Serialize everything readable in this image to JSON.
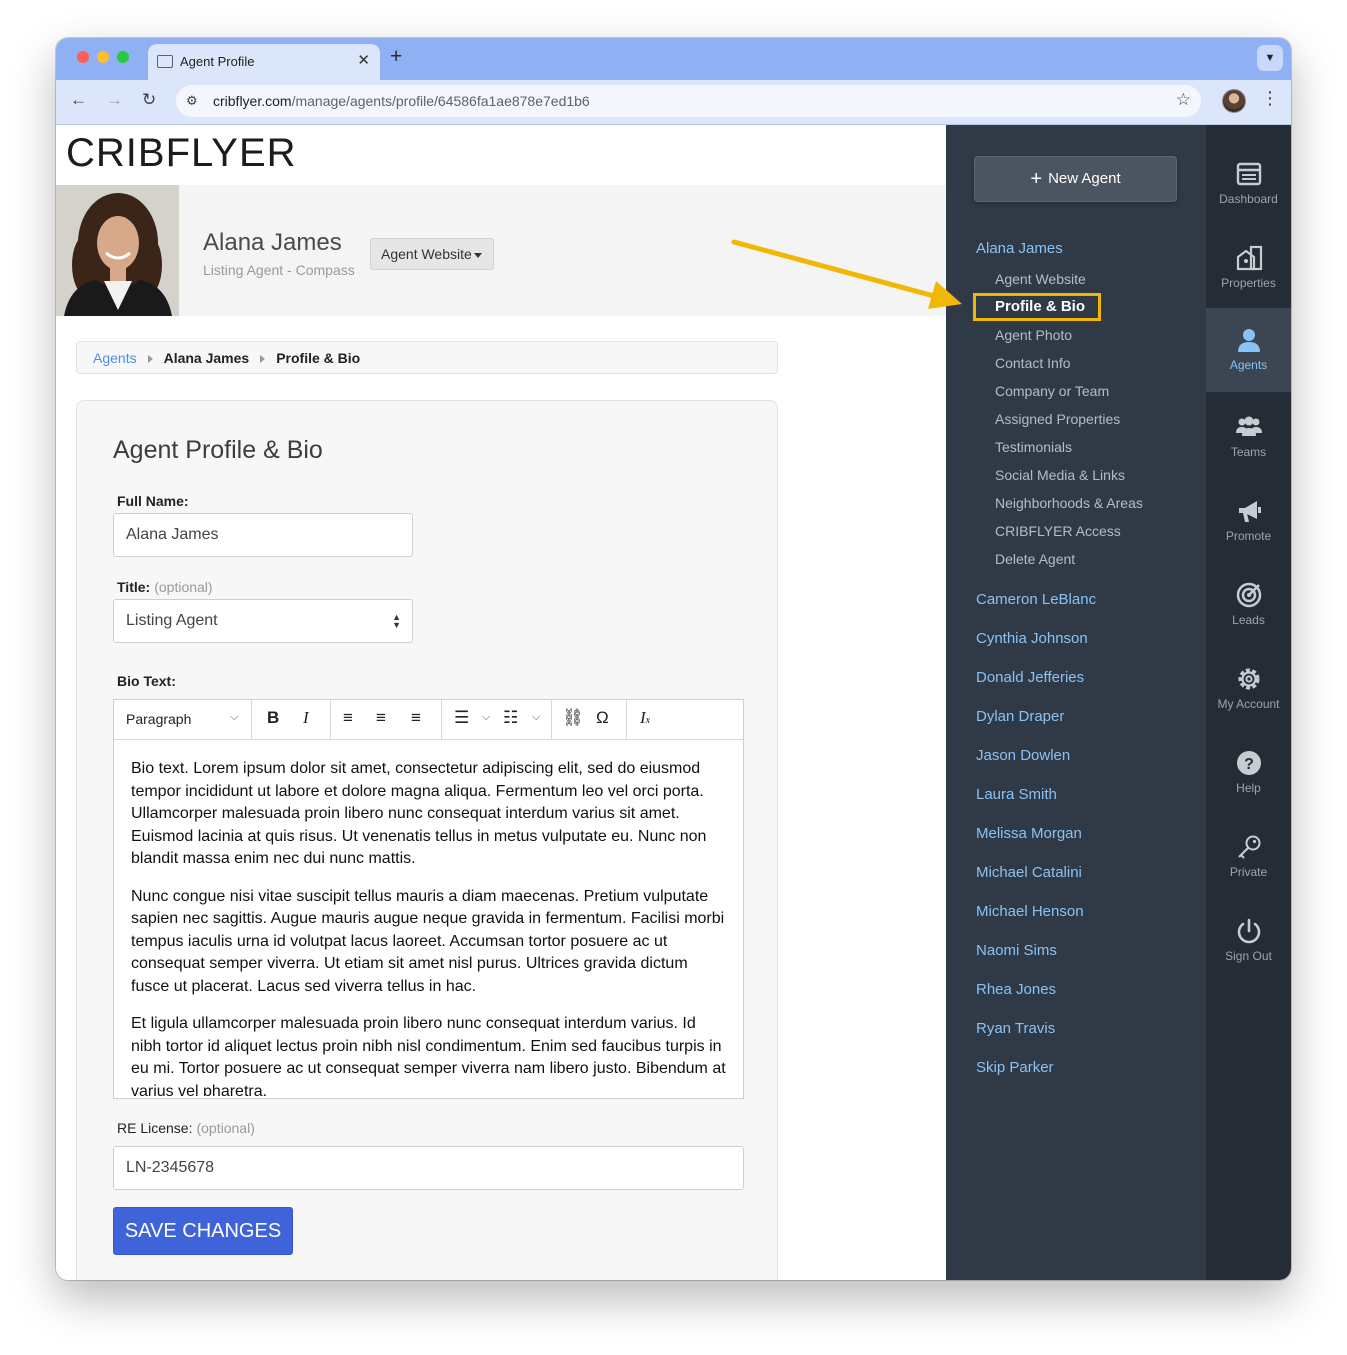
{
  "browser": {
    "tab_title": "Agent Profile",
    "url_host": "cribflyer.com",
    "url_path": "/manage/agents/profile/64586fa1ae878e7ed1b6"
  },
  "brand": {
    "logo": "CRIBFLYER"
  },
  "agent_header": {
    "name": "Alana James",
    "subtitle": "Listing Agent - Compass",
    "website_button": "Agent Website"
  },
  "breadcrumb": {
    "items": [
      "Agents",
      "Alana James",
      "Profile & Bio"
    ]
  },
  "form": {
    "title": "Agent Profile & Bio",
    "full_name_label": "Full Name:",
    "full_name_value": "Alana James",
    "title_label": "Title:",
    "optional": "(optional)",
    "title_value": "Listing Agent",
    "bio_label": "Bio Text:",
    "editor": {
      "block_format": "Paragraph",
      "paragraphs": [
        "Bio text. Lorem ipsum dolor sit amet, consectetur adipiscing elit, sed do eiusmod tempor incididunt ut labore et dolore magna aliqua. Fermentum leo vel orci porta. Ullamcorper malesuada proin libero nunc consequat interdum varius sit amet. Euismod lacinia at quis risus. Ut venenatis tellus in metus vulputate eu. Nunc non blandit massa enim nec dui nunc mattis.",
        "Nunc congue nisi vitae suscipit tellus mauris a diam maecenas. Pretium vulputate sapien nec sagittis. Augue mauris augue neque gravida in fermentum. Facilisi morbi tempus iaculis urna id volutpat lacus laoreet. Accumsan tortor posuere ac ut consequat semper viverra. Ut etiam sit amet nisl purus. Ultrices gravida dictum fusce ut placerat. Lacus sed viverra tellus in hac.",
        "Et ligula ullamcorper malesuada proin libero nunc consequat interdum varius. Id nibh tortor id aliquet lectus proin nibh nisl condimentum. Enim sed faucibus turpis in eu mi. Tortor posuere ac ut consequat semper viverra nam libero justo. Bibendum at varius vel pharetra."
      ]
    },
    "license_label": "RE License:",
    "license_value": "LN-2345678",
    "save_button": "SAVE CHANGES"
  },
  "agent_nav": {
    "new_agent": "New Agent",
    "current_agent": "Alana James",
    "sub_items": [
      "Agent Website",
      "Profile & Bio",
      "Agent Photo",
      "Contact Info",
      "Company or Team",
      "Assigned Properties",
      "Testimonials",
      "Social Media & Links",
      "Neighborhoods & Areas",
      "CRIBFLYER Access",
      "Delete Agent"
    ],
    "active_sub_item": "Profile & Bio",
    "other_agents": [
      "Cameron LeBlanc",
      "Cynthia Johnson",
      "Donald Jefferies",
      "Dylan Draper",
      "Jason Dowlen",
      "Laura Smith",
      "Melissa Morgan",
      "Michael Catalini",
      "Michael Henson",
      "Naomi Sims",
      "Rhea Jones",
      "Ryan Travis",
      "Skip Parker"
    ]
  },
  "icon_rail": [
    {
      "label": "Dashboard",
      "icon": "dashboard-icon"
    },
    {
      "label": "Properties",
      "icon": "properties-icon"
    },
    {
      "label": "Agents",
      "icon": "agents-icon",
      "active": true
    },
    {
      "label": "Teams",
      "icon": "teams-icon"
    },
    {
      "label": "Promote",
      "icon": "megaphone-icon"
    },
    {
      "label": "Leads",
      "icon": "target-icon"
    },
    {
      "label": "My Account",
      "icon": "gear-icon"
    },
    {
      "label": "Help",
      "icon": "help-icon"
    },
    {
      "label": "Private",
      "icon": "key-icon"
    },
    {
      "label": "Sign Out",
      "icon": "power-icon"
    }
  ],
  "colors": {
    "accent_link": "#89c2f4",
    "save_button": "#3f63d8",
    "sidebar_bg": "#303a46",
    "rail_bg": "#252c35",
    "highlight": "#f2b705"
  }
}
